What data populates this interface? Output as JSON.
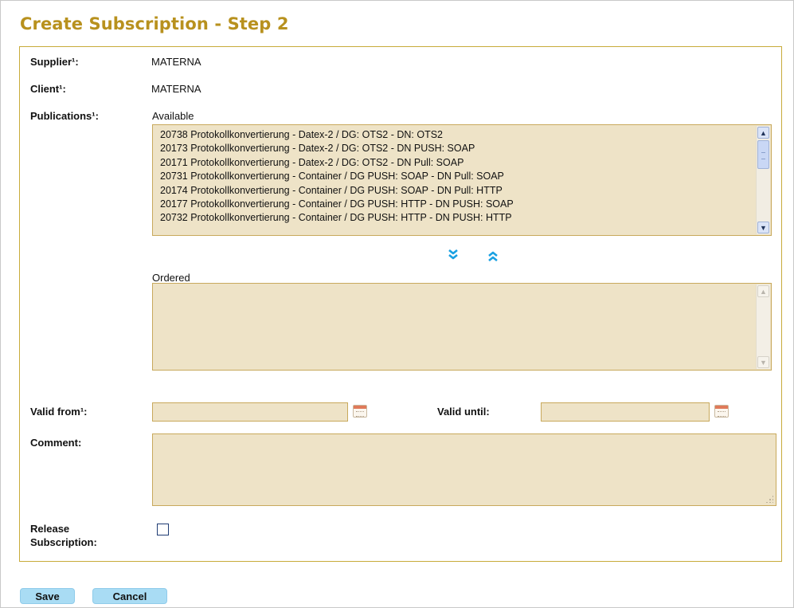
{
  "page": {
    "title": "Create Subscription - Step 2"
  },
  "form": {
    "supplier": {
      "label": "Supplier¹:",
      "value": "MATERNA"
    },
    "client": {
      "label": "Client¹:",
      "value": "MATERNA"
    },
    "publications": {
      "label": "Publications¹:",
      "available_label": "Available",
      "available_items": [
        "20738 Protokollkonvertierung - Datex-2 / DG: OTS2 - DN: OTS2",
        "20173 Protokollkonvertierung - Datex-2 / DG: OTS2 - DN PUSH: SOAP",
        "20171 Protokollkonvertierung - Datex-2 / DG: OTS2 - DN Pull: SOAP",
        "20731 Protokollkonvertierung - Container / DG PUSH: SOAP - DN Pull: SOAP",
        "20174 Protokollkonvertierung - Container / DG PUSH: SOAP - DN Pull: HTTP",
        "20177 Protokollkonvertierung - Container / DG PUSH: HTTP - DN PUSH: SOAP",
        "20732 Protokollkonvertierung - Container / DG PUSH: HTTP - DN PUSH: HTTP"
      ],
      "ordered_label": "Ordered",
      "ordered_items": []
    },
    "valid_from": {
      "label": "Valid from¹:",
      "value": ""
    },
    "valid_until": {
      "label": "Valid until:",
      "value": ""
    },
    "comment": {
      "label": "Comment:",
      "value": ""
    },
    "release": {
      "label_line1": "Release",
      "label_line2": "Subscription:",
      "checked": false
    }
  },
  "buttons": {
    "save": "Save",
    "cancel": "Cancel"
  },
  "icons": {
    "move_down": "double-chevron-down-icon",
    "move_up": "double-chevron-up-icon",
    "calendar": "calendar-icon"
  },
  "colors": {
    "title": "#b8911e",
    "border": "#c8ab3a",
    "field_bg": "#eee3c7",
    "button_bg": "#a9dcf4",
    "move_icon": "#18a0e2"
  }
}
